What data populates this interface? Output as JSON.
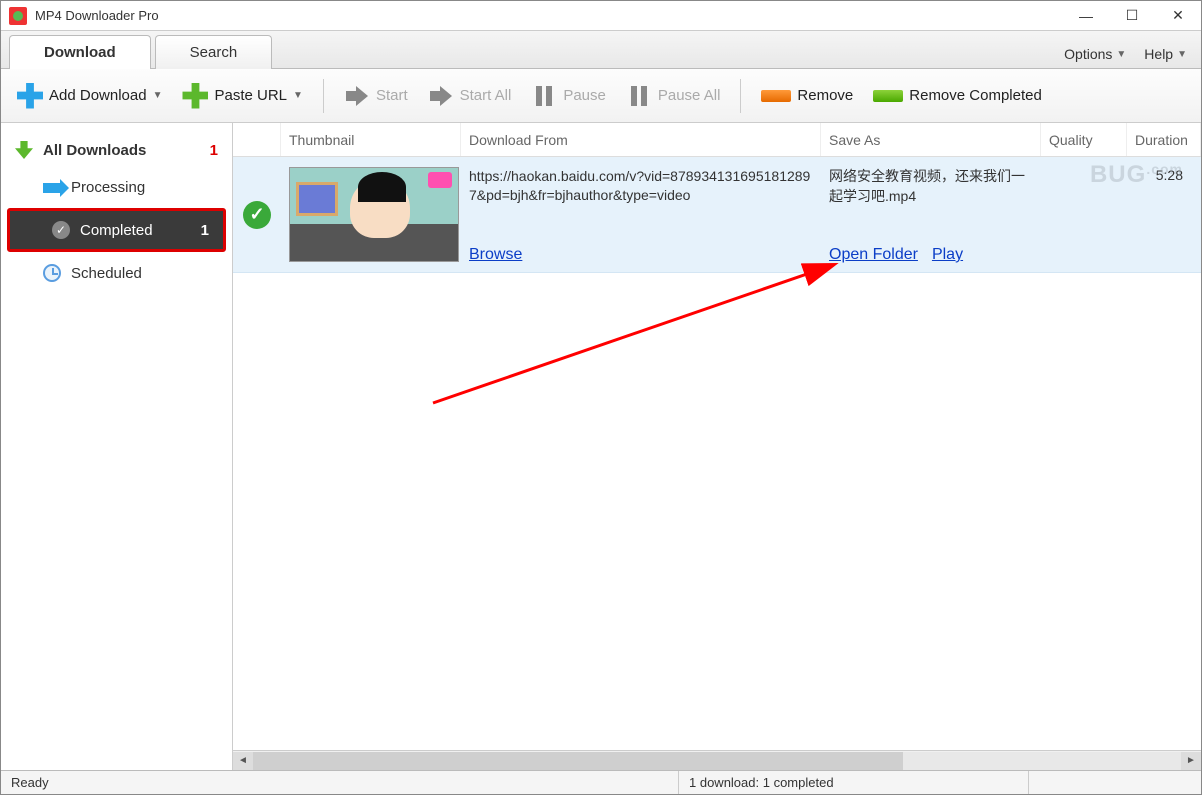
{
  "app": {
    "title": "MP4 Downloader Pro"
  },
  "win_controls": {
    "min": "—",
    "max": "☐",
    "close": "✕"
  },
  "tabs": {
    "download": "Download",
    "search": "Search",
    "options": "Options",
    "help": "Help"
  },
  "toolbar": {
    "add_download": "Add Download",
    "paste_url": "Paste URL",
    "start": "Start",
    "start_all": "Start All",
    "pause": "Pause",
    "pause_all": "Pause All",
    "remove": "Remove",
    "remove_completed": "Remove Completed"
  },
  "sidebar": {
    "all": {
      "label": "All Downloads",
      "count": "1"
    },
    "processing": {
      "label": "Processing"
    },
    "completed": {
      "label": "Completed",
      "count": "1"
    },
    "scheduled": {
      "label": "Scheduled"
    }
  },
  "columns": {
    "thumbnail": "Thumbnail",
    "from": "Download From",
    "save": "Save As",
    "quality": "Quality",
    "duration": "Duration"
  },
  "rows": [
    {
      "from": "https://haokan.baidu.com/v?vid=8789341316951812897&pd=bjh&fr=bjhauthor&type=video",
      "save": "网络安全教育视频，还来我们一起学习吧.mp4",
      "quality": "",
      "duration": "5:28",
      "browse": "Browse",
      "open_folder": "Open Folder",
      "play": "Play"
    }
  ],
  "watermark": {
    "text": "BUG",
    "suffix": ".com"
  },
  "status": {
    "ready": "Ready",
    "summary": "1 download: 1 completed"
  }
}
